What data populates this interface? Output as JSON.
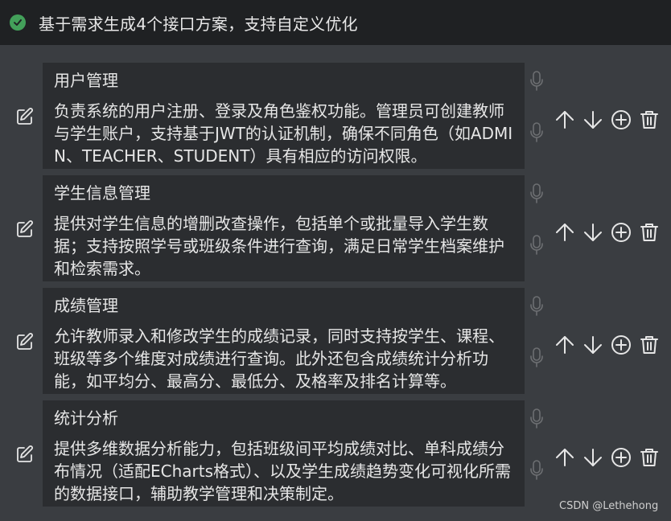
{
  "header": {
    "status_icon": "check-circle-icon",
    "title": "基于需求生成4个接口方案，支持自定义优化",
    "status_color": "#43a05a"
  },
  "cards": [
    {
      "title": "用户管理",
      "description": "负责系统的用户注册、登录及角色鉴权功能。管理员可创建教师与学生账户，支持基于JWT的认证机制，确保不同角色（如ADMIN、TEACHER、STUDENT）具有相应的访问权限。"
    },
    {
      "title": "学生信息管理",
      "description": "提供对学生信息的增删改查操作，包括单个或批量导入学生数据；支持按照学号或班级条件进行查询，满足日常学生档案维护和检索需求。"
    },
    {
      "title": "成绩管理",
      "description": "允许教师录入和修改学生的成绩记录，同时支持按学生、课程、班级等多个维度对成绩进行查询。此外还包含成绩统计分析功能，如平均分、最高分、最低分、及格率及排名计算等。"
    },
    {
      "title": "统计分析",
      "description": "提供多维数据分析能力，包括班级间平均成绩对比、单科成绩分布情况（适配ECharts格式）、以及学生成绩趋势变化可视化所需的数据接口，辅助教学管理和决策制定。"
    }
  ],
  "icons": {
    "edit": "edit-icon",
    "mic": "microphone-icon",
    "up": "arrow-up-icon",
    "down": "arrow-down-icon",
    "add": "add-circle-icon",
    "delete": "trash-icon"
  },
  "watermark": "CSDN @Lethehong"
}
